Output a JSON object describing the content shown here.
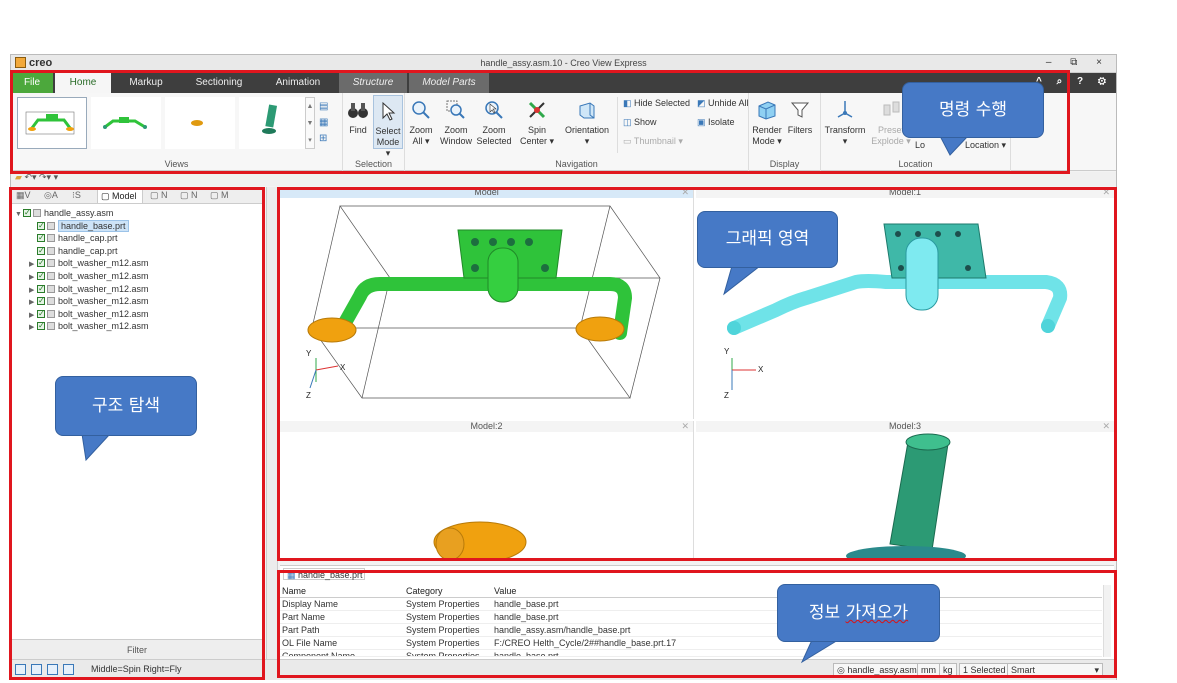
{
  "window": {
    "brand": "creo",
    "title": "handle_assy.asm.10 - Creo View Express",
    "controls": "– ⧉ ×"
  },
  "tabs": [
    "File",
    "Home",
    "Markup",
    "Sectioning",
    "Animation",
    "Structure",
    "Model Parts"
  ],
  "ribbon": {
    "views_label": "Views",
    "selection": {
      "label": "Selection",
      "find": "Find",
      "select": "Select",
      "mode": "Mode ▾"
    },
    "navigation": {
      "label": "Navigation",
      "zoom_all": [
        "Zoom",
        "All ▾"
      ],
      "zoom_window": [
        "Zoom",
        "Window"
      ],
      "zoom_selected": [
        "Zoom",
        "Selected"
      ],
      "spin_center": [
        "Spin",
        "Center ▾"
      ],
      "orientation": [
        "Orientation",
        "▾"
      ],
      "hide_selected": "Hide Selected",
      "unhide_all": "Unhide All",
      "show": "Show",
      "isolate": "Isolate",
      "thumbnail": "Thumbnail ▾"
    },
    "display": {
      "label": "Display",
      "render": [
        "Render",
        "Mode ▾"
      ],
      "filters": "Filters"
    },
    "location": {
      "label": "Location",
      "transform": [
        "Transform",
        "▾"
      ],
      "preset": [
        "Preset",
        "Explode ▾"
      ],
      "lo": "Lo",
      "location_btn": "Location ▾"
    }
  },
  "left_panel": {
    "tabs": [
      "V",
      "A",
      "S",
      "Model",
      "N",
      "N",
      "M"
    ],
    "tree": [
      {
        "label": "handle_assy.asm",
        "level": 0,
        "expander": "▼",
        "checked": true,
        "selected": false
      },
      {
        "label": "handle_base.prt",
        "level": 1,
        "expander": "",
        "checked": true,
        "selected": true
      },
      {
        "label": "handle_cap.prt",
        "level": 1,
        "expander": "",
        "checked": true,
        "selected": false
      },
      {
        "label": "handle_cap.prt",
        "level": 1,
        "expander": "",
        "checked": true,
        "selected": false
      },
      {
        "label": "bolt_washer_m12.asm",
        "level": 1,
        "expander": "▶",
        "checked": true,
        "selected": false
      },
      {
        "label": "bolt_washer_m12.asm",
        "level": 1,
        "expander": "▶",
        "checked": true,
        "selected": false
      },
      {
        "label": "bolt_washer_m12.asm",
        "level": 1,
        "expander": "▶",
        "checked": true,
        "selected": false
      },
      {
        "label": "bolt_washer_m12.asm",
        "level": 1,
        "expander": "▶",
        "checked": true,
        "selected": false
      },
      {
        "label": "bolt_washer_m12.asm",
        "level": 1,
        "expander": "▶",
        "checked": true,
        "selected": false
      },
      {
        "label": "bolt_washer_m12.asm",
        "level": 1,
        "expander": "▶",
        "checked": true,
        "selected": false
      }
    ],
    "filter": "Filter"
  },
  "viewports": [
    "Model",
    "Model:1",
    "Model:2",
    "Model:3"
  ],
  "axes": {
    "y": "Y",
    "x": "X",
    "z": "Z"
  },
  "info": {
    "tab": "handle_base.prt",
    "headers": [
      "Name",
      "Category",
      "Value"
    ],
    "rows": [
      [
        "Display Name",
        "System Properties",
        "handle_base.prt"
      ],
      [
        "Part Name",
        "System Properties",
        "handle_base.prt"
      ],
      [
        "Part Path",
        "System Properties",
        "handle_assy.asm/handle_base.prt"
      ],
      [
        "OL File Name",
        "System Properties",
        "F:/CREO Helth_Cycle/2##handle_base.prt.17"
      ],
      [
        "Component Name",
        "System Properties",
        "handle_base.prt"
      ]
    ]
  },
  "status": {
    "mouse_hint": "Middle=Spin   Right=Fly",
    "model": "handle_assy.asm",
    "unit_length": "mm",
    "unit_mass": "kg",
    "selected": "1 Selected",
    "mode": "Smart"
  },
  "annotations": {
    "command": "명령 수행",
    "graphics": "그래픽 영역",
    "structure": "구조 탐색",
    "info_pre": "정보 ",
    "info_err": "가져오가"
  },
  "colors": {
    "annotation_red": "#e0161e",
    "callout_blue": "#4679c6",
    "model_green": "#2fc33a",
    "model_cyan": "#6fe3e8",
    "cap_orange": "#f0a10f",
    "teal": "#2c9a74"
  }
}
